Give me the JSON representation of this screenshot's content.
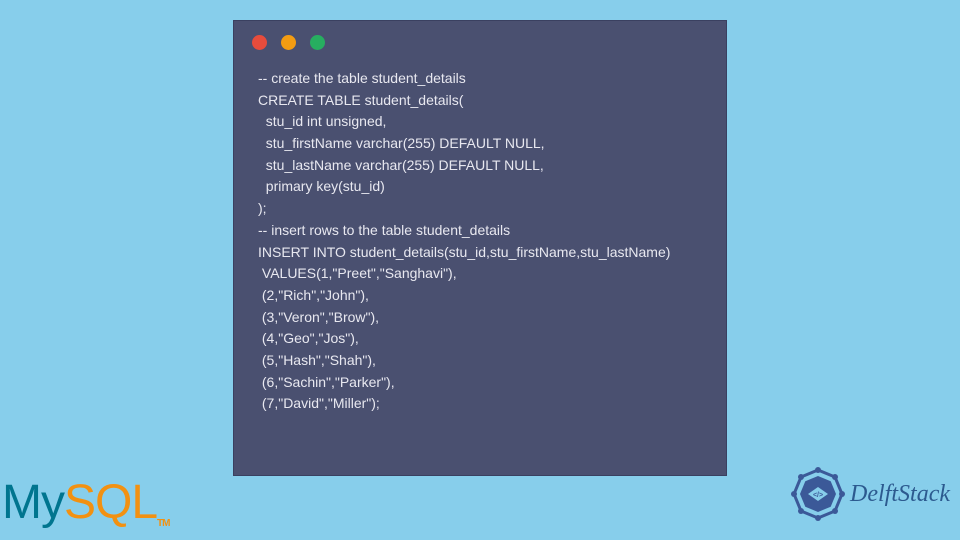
{
  "code": {
    "lines": "-- create the table student_details\nCREATE TABLE student_details(\n  stu_id int unsigned,\n  stu_firstName varchar(255) DEFAULT NULL,\n  stu_lastName varchar(255) DEFAULT NULL,\n  primary key(stu_id)\n);\n-- insert rows to the table student_details\nINSERT INTO student_details(stu_id,stu_firstName,stu_lastName)\n VALUES(1,\"Preet\",\"Sanghavi\"),\n (2,\"Rich\",\"John\"),\n (3,\"Veron\",\"Brow\"),\n (4,\"Geo\",\"Jos\"),\n (5,\"Hash\",\"Shah\"),\n (6,\"Sachin\",\"Parker\"),\n (7,\"David\",\"Miller\");"
  },
  "logos": {
    "mysql_my": "My",
    "mysql_sql": "SQL",
    "mysql_tm": "TM",
    "delftstack": "DelftStack"
  }
}
